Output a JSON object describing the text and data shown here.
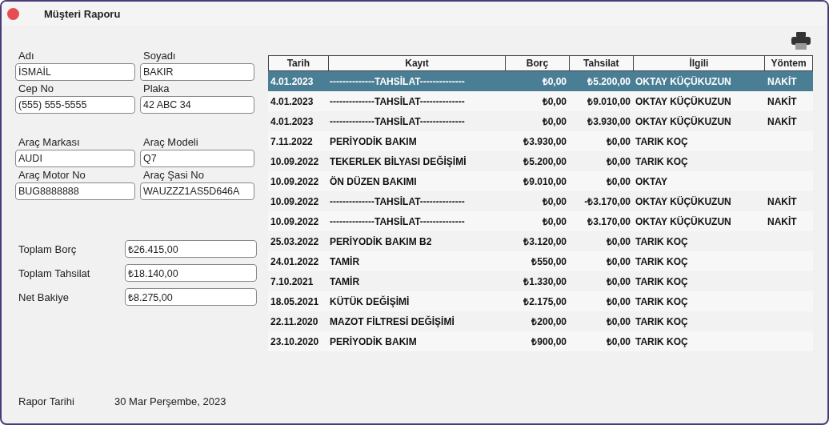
{
  "window": {
    "title": "Müşteri Raporu"
  },
  "customer_fields": [
    {
      "label": "Adı",
      "value": "İSMAİL"
    },
    {
      "label": "Soyadı",
      "value": "BAKIR"
    },
    {
      "label": "Cep No",
      "value": "(555) 555-5555"
    },
    {
      "label": "Plaka",
      "value": "42 ABC 34"
    }
  ],
  "vehicle_fields": [
    {
      "label": "Araç Markası",
      "value": "AUDI"
    },
    {
      "label": "Araç Modeli",
      "value": "Q7"
    },
    {
      "label": "Araç Motor No",
      "value": "BUG8888888"
    },
    {
      "label": "Araç Şasi No",
      "value": "WAUZZZ1AS5D646A"
    }
  ],
  "totals": [
    {
      "label": "Toplam Borç",
      "value": "₺26.415,00"
    },
    {
      "label": "Toplam Tahsilat",
      "value": "₺18.140,00"
    },
    {
      "label": "Net Bakiye",
      "value": "₺8.275,00"
    }
  ],
  "report_date": {
    "label": "Rapor Tarihi",
    "value": "30 Mar Perşembe, 2023"
  },
  "table": {
    "columns": [
      "Tarih",
      "Kayıt",
      "Borç",
      "Tahsilat",
      "İlgili",
      "Yöntem"
    ],
    "rows": [
      {
        "selected": true,
        "cells": [
          "4.01.2023",
          "--------------TAHSİLAT--------------",
          "₺0,00",
          "₺5.200,00",
          "OKTAY KÜÇÜKUZUN",
          "NAKİT"
        ]
      },
      {
        "selected": false,
        "cells": [
          "4.01.2023",
          "--------------TAHSİLAT--------------",
          "₺0,00",
          "₺9.010,00",
          "OKTAY KÜÇÜKUZUN",
          "NAKİT"
        ]
      },
      {
        "selected": false,
        "cells": [
          "4.01.2023",
          "--------------TAHSİLAT--------------",
          "₺0,00",
          "₺3.930,00",
          "OKTAY KÜÇÜKUZUN",
          "NAKİT"
        ]
      },
      {
        "selected": false,
        "cells": [
          "7.11.2022",
          "PERİYODİK BAKIM",
          "₺3.930,00",
          "₺0,00",
          "TARIK KOÇ",
          ""
        ]
      },
      {
        "selected": false,
        "cells": [
          "10.09.2022",
          "TEKERLEK BİLYASI DEĞİŞİMİ",
          "₺5.200,00",
          "₺0,00",
          "TARIK KOÇ",
          ""
        ]
      },
      {
        "selected": false,
        "cells": [
          "10.09.2022",
          "ÖN DÜZEN BAKIMI",
          "₺9.010,00",
          "₺0,00",
          "OKTAY",
          ""
        ]
      },
      {
        "selected": false,
        "cells": [
          "10.09.2022",
          "--------------TAHSİLAT--------------",
          "₺0,00",
          "-₺3.170,00",
          "OKTAY KÜÇÜKUZUN",
          "NAKİT"
        ]
      },
      {
        "selected": false,
        "cells": [
          "10.09.2022",
          "--------------TAHSİLAT--------------",
          "₺0,00",
          "₺3.170,00",
          "OKTAY KÜÇÜKUZUN",
          "NAKİT"
        ]
      },
      {
        "selected": false,
        "cells": [
          "25.03.2022",
          "PERİYODİK BAKIM B2",
          "₺3.120,00",
          "₺0,00",
          "TARIK KOÇ",
          ""
        ]
      },
      {
        "selected": false,
        "cells": [
          "24.01.2022",
          "TAMİR",
          "₺550,00",
          "₺0,00",
          "TARIK KOÇ",
          ""
        ]
      },
      {
        "selected": false,
        "cells": [
          "7.10.2021",
          "TAMİR",
          "₺1.330,00",
          "₺0,00",
          "TARIK KOÇ",
          ""
        ]
      },
      {
        "selected": false,
        "cells": [
          "18.05.2021",
          "KÜTÜK DEĞİŞİMİ",
          "₺2.175,00",
          "₺0,00",
          "TARIK KOÇ",
          ""
        ]
      },
      {
        "selected": false,
        "cells": [
          "22.11.2020",
          "MAZOT FİLTRESİ DEĞİŞİMİ",
          "₺200,00",
          "₺0,00",
          "TARIK KOÇ",
          ""
        ]
      },
      {
        "selected": false,
        "cells": [
          "23.10.2020",
          "PERİYODİK BAKIM",
          "₺900,00",
          "₺0,00",
          "TARIK KOÇ",
          ""
        ]
      }
    ]
  }
}
